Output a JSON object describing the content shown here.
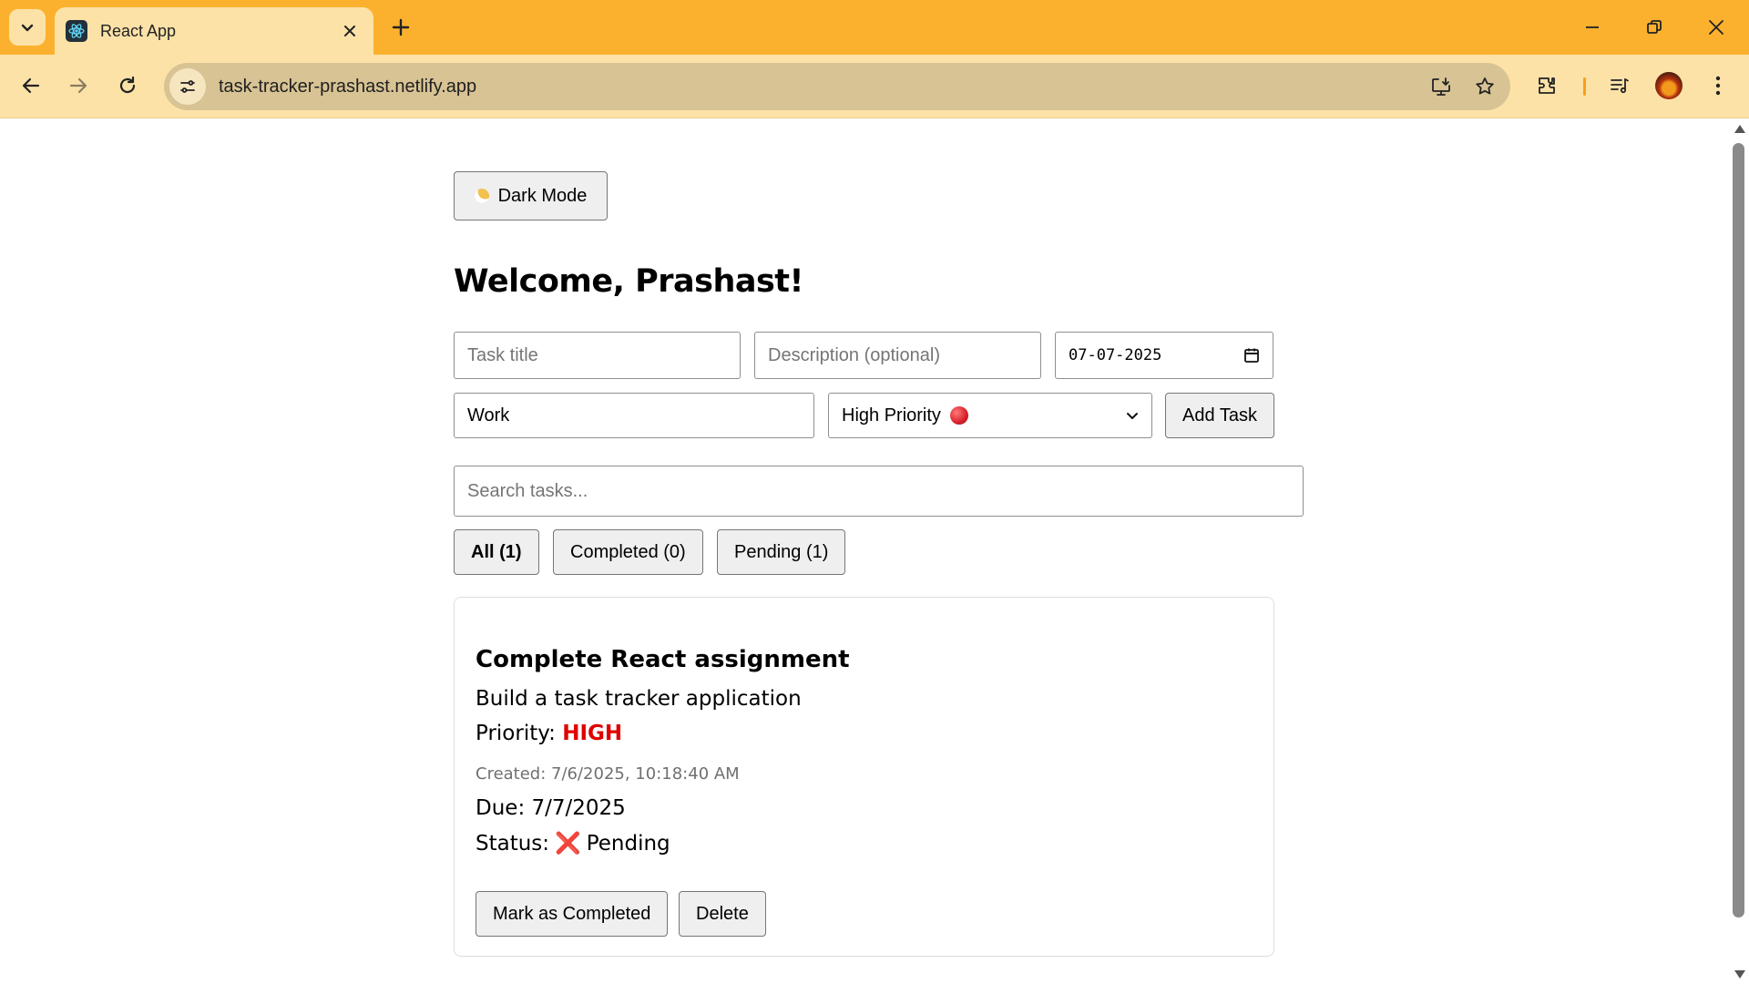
{
  "browser": {
    "tab_title": "React App",
    "url": "task-tracker-prashast.netlify.app",
    "accent_color": "#fcb12e"
  },
  "page": {
    "dark_mode_label": "Dark Mode",
    "welcome": "Welcome, Prashast!",
    "form": {
      "title_placeholder": "Task title",
      "description_placeholder": "Description (optional)",
      "due_date_value": "07-07-2025",
      "category_value": "Work",
      "priority_value": "High Priority",
      "add_task_label": "Add Task"
    },
    "search_placeholder": "Search tasks...",
    "filters": [
      {
        "label": "All (1)",
        "active": true
      },
      {
        "label": "Completed (0)",
        "active": false
      },
      {
        "label": "Pending (1)",
        "active": false
      }
    ],
    "task": {
      "title": "Complete React assignment",
      "description": "Build a task tracker application",
      "priority_label": "Priority:",
      "priority_value": "HIGH",
      "priority_color": "#e00000",
      "created": "Created: 7/6/2025, 10:18:40 AM",
      "due": "Due: 7/7/2025",
      "status_label": "Status:",
      "status_icon": "cross-mark-icon",
      "status_value": "Pending",
      "complete_button": "Mark as Completed",
      "delete_button": "Delete"
    }
  }
}
